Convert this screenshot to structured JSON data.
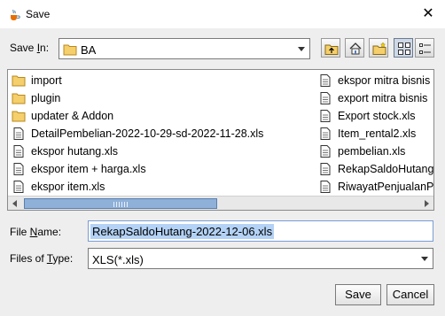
{
  "window": {
    "title": "Save",
    "close_glyph": "✕"
  },
  "save_in": {
    "label_pre": "Save ",
    "label_u": "I",
    "label_post": "n:",
    "value": "BA",
    "icon": "folder-icon"
  },
  "toolbar": [
    {
      "name": "up-one-level-button",
      "icon": "folder-up-icon"
    },
    {
      "name": "home-button",
      "icon": "home-icon"
    },
    {
      "name": "new-folder-button",
      "icon": "new-folder-icon"
    },
    {
      "name": "list-view-button",
      "icon": "list-view-icon",
      "active": true
    },
    {
      "name": "details-view-button",
      "icon": "details-view-icon"
    }
  ],
  "files_col1": [
    {
      "name": "import",
      "type": "folder"
    },
    {
      "name": "plugin",
      "type": "folder"
    },
    {
      "name": "updater & Addon",
      "type": "folder"
    },
    {
      "name": "DetailPembelian-2022-10-29-sd-2022-11-28.xls",
      "type": "file"
    },
    {
      "name": "ekspor hutang.xls",
      "type": "file"
    },
    {
      "name": "ekspor item + harga.xls",
      "type": "file"
    },
    {
      "name": "ekspor item.xls",
      "type": "file"
    }
  ],
  "files_col2": [
    {
      "name": "ekspor mitra bisnis",
      "type": "file"
    },
    {
      "name": "export mitra bisnis",
      "type": "file"
    },
    {
      "name": "Export stock.xls",
      "type": "file"
    },
    {
      "name": "Item_rental2.xls",
      "type": "file"
    },
    {
      "name": "pembelian.xls",
      "type": "file"
    },
    {
      "name": "RekapSaldoHutang",
      "type": "file"
    },
    {
      "name": "RiwayatPenjualanP",
      "type": "file"
    }
  ],
  "file_name": {
    "label_pre": "File ",
    "label_u": "N",
    "label_post": "ame:",
    "value": "RekapSaldoHutang-2022-12-06.xls"
  },
  "file_type": {
    "label_pre": "Files of ",
    "label_u": "T",
    "label_post": "ype:",
    "value": "XLS(*.xls)"
  },
  "buttons": {
    "save": "Save",
    "cancel": "Cancel"
  }
}
